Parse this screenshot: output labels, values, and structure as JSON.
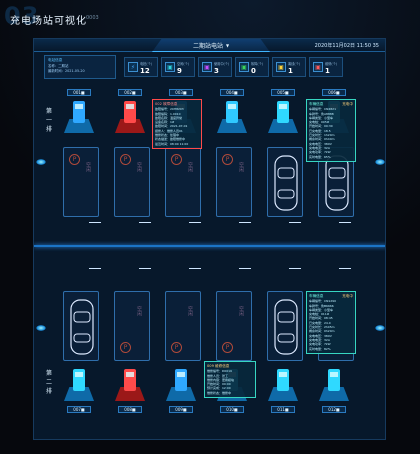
{
  "page": {
    "deco_number": "03",
    "title": "充电场站可视化",
    "code": "0003"
  },
  "header": {
    "station": "二期站电站",
    "station_dropdown_icon": "chevron-down-icon",
    "datetime": "2020年11月02日  11:50  35"
  },
  "info_card": {
    "title": "电站信息",
    "line1": "名称：二期站",
    "line2": "最新时间：2021-05-20"
  },
  "stats": [
    {
      "icon": "charger-icon",
      "label": "电桩(个)",
      "value": "12",
      "color": "#48a8ff"
    },
    {
      "icon": "idle-icon",
      "label": "空闲(个)",
      "value": "9",
      "color": "#2fd4e0"
    },
    {
      "icon": "busy-icon",
      "label": "使用中(个)",
      "value": "3",
      "color": "#c64dff"
    },
    {
      "icon": "fault-icon",
      "label": "故障(个)",
      "value": "0",
      "color": "#3bd45d"
    },
    {
      "icon": "warning-icon",
      "label": "离线(个)",
      "value": "1",
      "color": "#ffd33a"
    },
    {
      "icon": "repair-icon",
      "label": "维修(个)",
      "value": "1",
      "color": "#ff5a5a"
    }
  ],
  "rows": [
    {
      "label": "第一排"
    },
    {
      "label": "第二排"
    }
  ],
  "slots_top": [
    "001■",
    "002■",
    "003■",
    "004■",
    "005■",
    "006■"
  ],
  "slots_bottom": [
    "007■",
    "008■",
    "009■",
    "010■",
    "011■",
    "012■"
  ],
  "spot_texts_top": [
    "空闲",
    "空闲",
    "空闲",
    "空闲",
    "",
    ""
  ],
  "spot_texts_bottom": [
    "",
    "空闲",
    "空闲",
    "空闲",
    "",
    ""
  ],
  "popup_red": {
    "title": "002 故障信息",
    "lines": [
      "故障编号：20H8203",
      "故障编码：1.0010",
      "故障名称：温度异常",
      "设备名称：1#",
      "故障时间：2021-07-01",
      "报修人：维修人员01",
      "维修状态：处理中",
      "状态描述：故障维修中",
      "最近时间：08:00 11:00"
    ]
  },
  "popup_top": {
    "title": "车辆信息",
    "status": "充电中",
    "lines": [
      "车辆编号：CN4821",
      "车牌号：鲁A8888",
      "车辆类型：小型车",
      "充电桩：005#",
      "开始时间：09:30",
      "已充电量：18.5",
      "已充时长：1h20m",
      "剩余时间：0h40m",
      "充电电压：380V",
      "充电电流：32A",
      "充电功率：7kW",
      "实时电量：65%"
    ]
  },
  "popup_bottom": {
    "title": "车辆信息",
    "status": "充电中",
    "lines": [
      "车辆编号：CN1290",
      "车牌号：鲁B6666",
      "车辆类型：小型车",
      "充电桩：011#",
      "开始时间：08:45",
      "已充电量：24.0",
      "已充时长：2h05m",
      "剩余时间：0h20m",
      "充电电压：380V",
      "充电电流：32A",
      "充电功率：7kW",
      "实时电量：82%"
    ]
  },
  "popup_bottom_left": {
    "title": "009 维修信息",
    "lines": [
      "维修编号：D0019",
      "维修人员：张工",
      "维修内容：更换模块",
      "开始时间：09:00",
      "预计完成：12:00",
      "维修状态：维修中"
    ]
  }
}
